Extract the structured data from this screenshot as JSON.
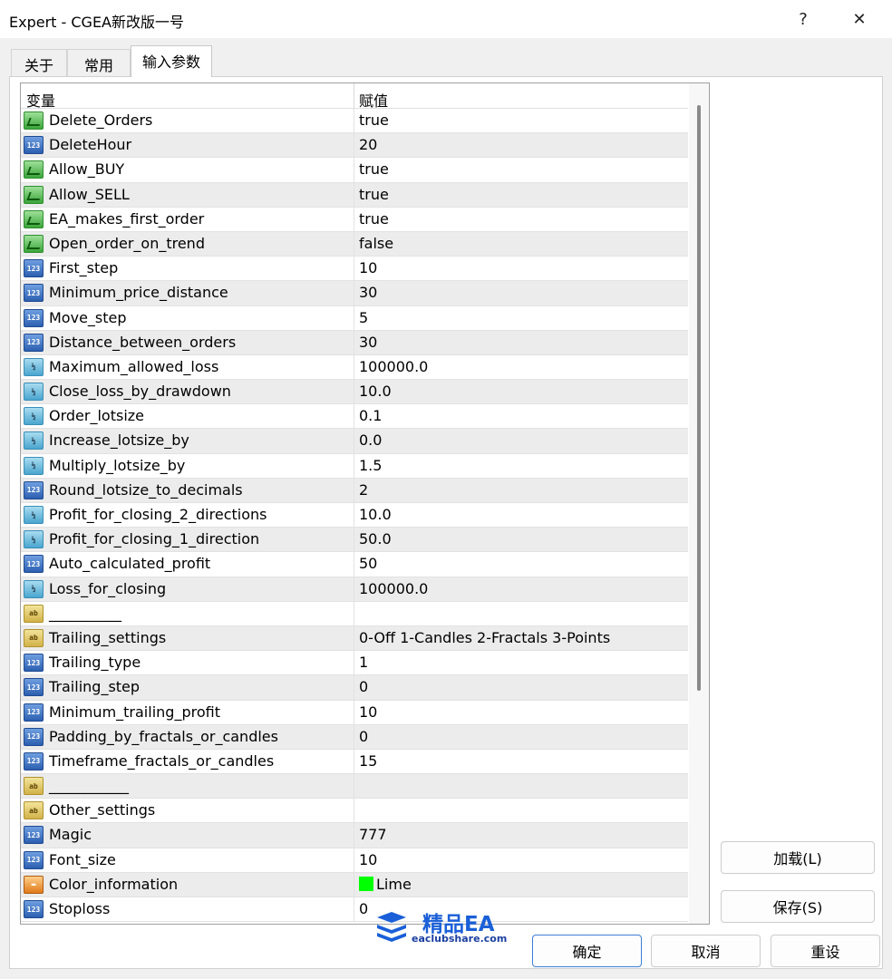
{
  "window": {
    "title": "Expert - CGEA新改版一号",
    "help_label": "?",
    "close_label": "✕"
  },
  "tabs": [
    {
      "label": "关于",
      "active": false
    },
    {
      "label": "常用",
      "active": false
    },
    {
      "label": "输入参数",
      "active": true
    }
  ],
  "grid": {
    "headers": {
      "variable": "变量",
      "value": "赋值"
    },
    "rows": [
      {
        "type": "bool",
        "name": "Delete_Orders",
        "value": "true"
      },
      {
        "type": "int",
        "name": "DeleteHour",
        "value": "20"
      },
      {
        "type": "bool",
        "name": "Allow_BUY",
        "value": "true"
      },
      {
        "type": "bool",
        "name": "Allow_SELL",
        "value": "true"
      },
      {
        "type": "bool",
        "name": "EA_makes_first_order",
        "value": "true"
      },
      {
        "type": "bool",
        "name": "Open_order_on_trend",
        "value": "false"
      },
      {
        "type": "int",
        "name": "First_step",
        "value": "10"
      },
      {
        "type": "int",
        "name": "Minimum_price_distance",
        "value": "30"
      },
      {
        "type": "int",
        "name": "Move_step",
        "value": "5"
      },
      {
        "type": "int",
        "name": "Distance_between_orders",
        "value": "30"
      },
      {
        "type": "dbl",
        "name": "Maximum_allowed_loss",
        "value": "100000.0"
      },
      {
        "type": "dbl",
        "name": "Close_loss_by_drawdown",
        "value": "10.0"
      },
      {
        "type": "dbl",
        "name": "Order_lotsize",
        "value": "0.1"
      },
      {
        "type": "dbl",
        "name": "Increase_lotsize_by",
        "value": "0.0"
      },
      {
        "type": "dbl",
        "name": "Multiply_lotsize_by",
        "value": "1.5"
      },
      {
        "type": "int",
        "name": "Round_lotsize_to_decimals",
        "value": "2"
      },
      {
        "type": "dbl",
        "name": "Profit_for_closing_2_directions",
        "value": "10.0"
      },
      {
        "type": "dbl",
        "name": "Profit_for_closing_1_direction",
        "value": "50.0"
      },
      {
        "type": "int",
        "name": "Auto_calculated_profit",
        "value": "50"
      },
      {
        "type": "dbl",
        "name": "Loss_for_closing",
        "value": "100000.0"
      },
      {
        "type": "str",
        "name": "__________",
        "value": ""
      },
      {
        "type": "str",
        "name": "Trailing_settings",
        "value": "0-Off  1-Candles  2-Fractals  3-Points"
      },
      {
        "type": "int",
        "name": "Trailing_type",
        "value": "1"
      },
      {
        "type": "int",
        "name": "Trailing_step",
        "value": "0"
      },
      {
        "type": "int",
        "name": "Minimum_trailing_profit",
        "value": "10"
      },
      {
        "type": "int",
        "name": "Padding_by_fractals_or_candles",
        "value": "0"
      },
      {
        "type": "int",
        "name": "Timeframe_fractals_or_candles",
        "value": "15"
      },
      {
        "type": "str",
        "name": "___________",
        "value": ""
      },
      {
        "type": "str",
        "name": "Other_settings",
        "value": ""
      },
      {
        "type": "int",
        "name": "Magic",
        "value": "777"
      },
      {
        "type": "int",
        "name": "Font_size",
        "value": "10"
      },
      {
        "type": "col",
        "name": "Color_information",
        "value": "Lime",
        "swatch": "#00ff00"
      },
      {
        "type": "int",
        "name": "Stoploss",
        "value": "0"
      }
    ]
  },
  "icons": {
    "bool": "checkmark-icon",
    "int": "integer-icon",
    "dbl": "double-icon",
    "str": "string-icon",
    "col": "color-icon"
  },
  "icon_glyphs": {
    "int": "123",
    "dbl": "½",
    "str": "ab",
    "col": "▬",
    "bool": ""
  },
  "buttons": {
    "load": "加载(L)",
    "save": "保存(S)",
    "ok": "确定",
    "cancel": "取消",
    "reset": "重设"
  },
  "watermark": {
    "title": "精品EA",
    "url": "eaclubshare.com"
  }
}
